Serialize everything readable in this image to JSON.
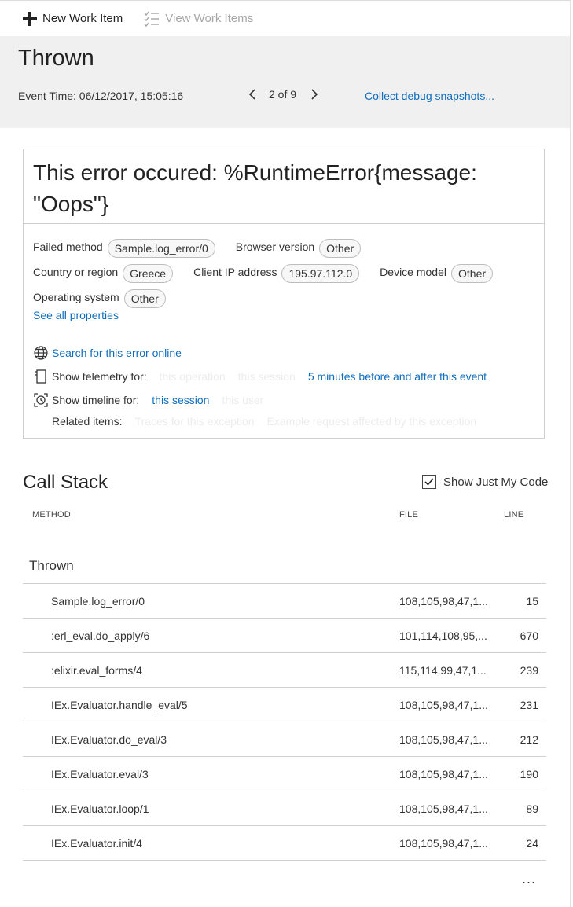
{
  "toolbar": {
    "new_work_item": "New Work Item",
    "view_work_items": "View Work Items"
  },
  "header": {
    "title": "Thrown",
    "event_time": "Event Time: 06/12/2017, 15:05:16",
    "pager": "2 of 9",
    "collect_debug": "Collect debug snapshots..."
  },
  "error": {
    "title": "This error occured: %RuntimeError{message: \"Oops\"}",
    "properties": {
      "failed_method_label": "Failed method",
      "failed_method_value": "Sample.log_error/0",
      "browser_version_label": "Browser version",
      "browser_version_value": "Other",
      "country_label": "Country or region",
      "country_value": "Greece",
      "client_ip_label": "Client IP address",
      "client_ip_value": "195.97.112.0",
      "device_model_label": "Device model",
      "device_model_value": "Other",
      "os_label": "Operating system",
      "os_value": "Other"
    },
    "see_all": "See all properties",
    "search_online": "Search for this error online",
    "telemetry_label": "Show telemetry for:",
    "telemetry_operation": "this operation",
    "telemetry_session": "this session",
    "telemetry_window": "5 minutes before and after this event",
    "timeline_label": "Show timeline for:",
    "timeline_session": "this session",
    "timeline_user": "this user",
    "related_label": "Related items:",
    "related_traces": "Traces for this exception",
    "related_request": "Example request affected by this exception"
  },
  "call_stack": {
    "title": "Call Stack",
    "just_my_code": "Show Just My Code",
    "col_method": "METHOD",
    "col_file": "FILE",
    "col_line": "LINE",
    "group": "Thrown",
    "rows": [
      {
        "method": "Sample.log_error/0",
        "file": "108,105,98,47,1...",
        "line": "15"
      },
      {
        "method": ":erl_eval.do_apply/6",
        "file": "101,114,108,95,...",
        "line": "670"
      },
      {
        "method": ":elixir.eval_forms/4",
        "file": "115,114,99,47,1...",
        "line": "239"
      },
      {
        "method": "IEx.Evaluator.handle_eval/5",
        "file": "108,105,98,47,1...",
        "line": "231"
      },
      {
        "method": "IEx.Evaluator.do_eval/3",
        "file": "108,105,98,47,1...",
        "line": "212"
      },
      {
        "method": "IEx.Evaluator.eval/3",
        "file": "108,105,98,47,1...",
        "line": "190"
      },
      {
        "method": "IEx.Evaluator.loop/1",
        "file": "108,105,98,47,1...",
        "line": "89"
      },
      {
        "method": "IEx.Evaluator.init/4",
        "file": "108,105,98,47,1...",
        "line": "24"
      }
    ],
    "more": "..."
  }
}
